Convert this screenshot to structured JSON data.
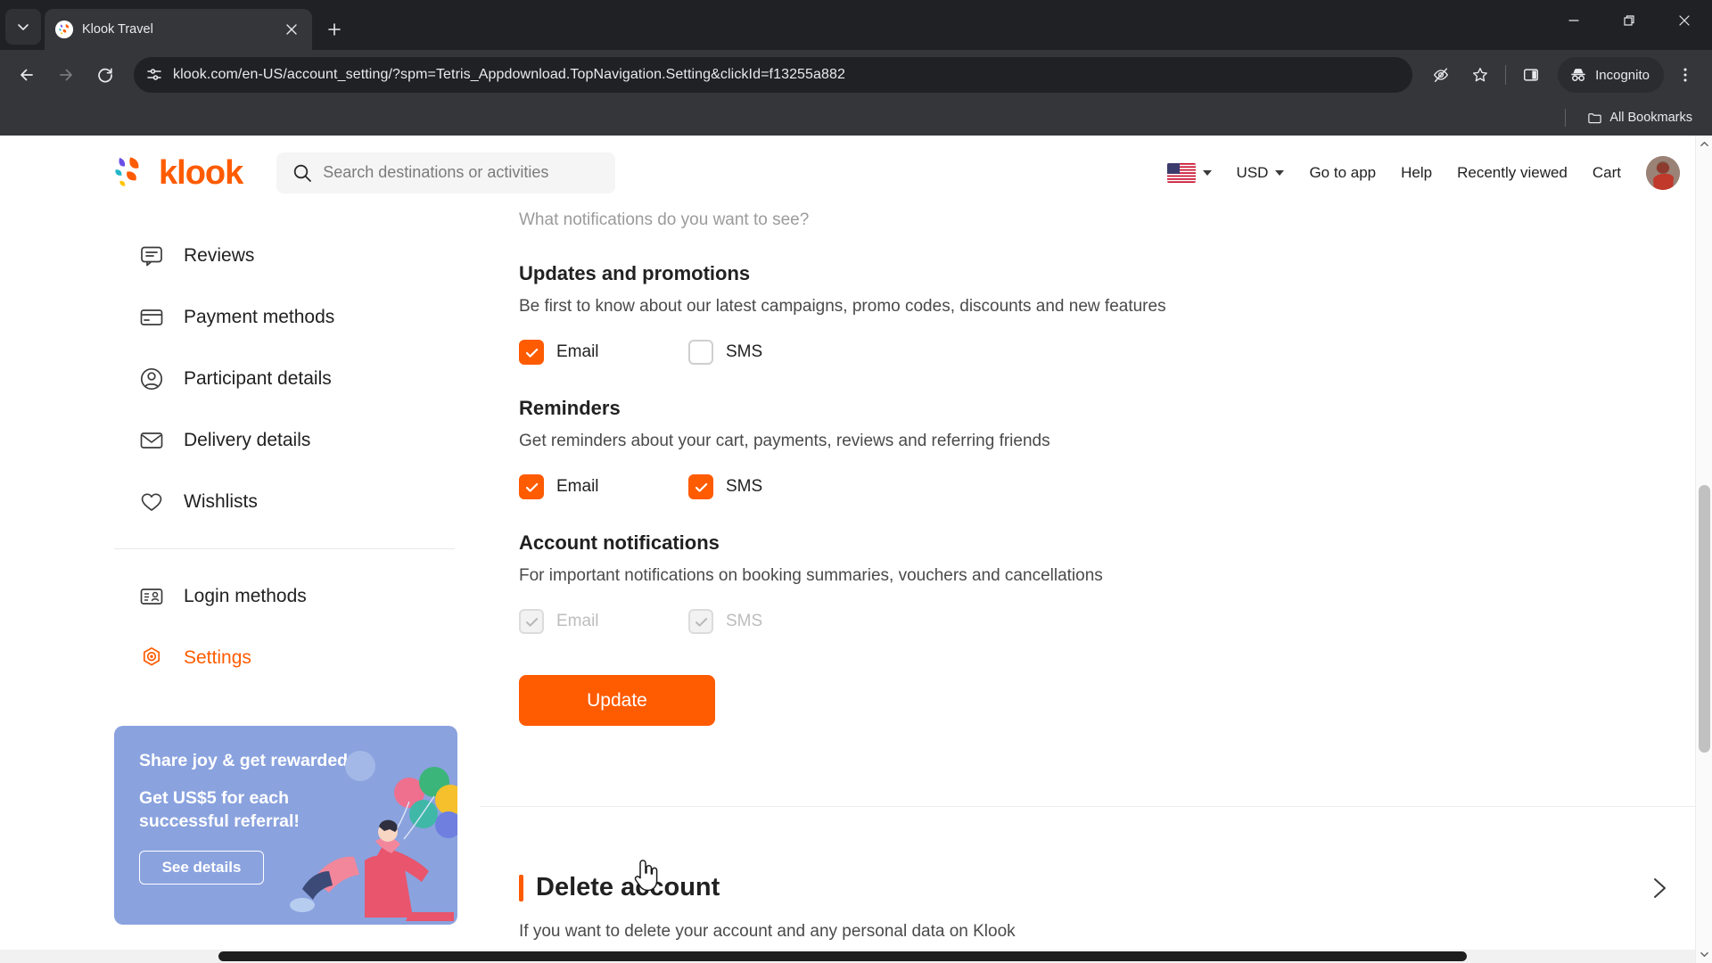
{
  "browser": {
    "tab": {
      "title": "Klook Travel",
      "favicon": "klook-favicon"
    },
    "tab_search_icon": "chevron-down-icon",
    "new_tab_icon": "plus-icon",
    "close_tab_icon": "close-icon",
    "window_controls": {
      "minimize": "minimize-icon",
      "maximize": "restore-icon",
      "close": "close-icon"
    },
    "nav": {
      "back_icon": "arrow-left-icon",
      "forward_icon": "arrow-right-icon",
      "reload_icon": "reload-icon"
    },
    "omnibox": {
      "site_icon": "page-settings-icon",
      "url": "klook.com/en-US/account_setting/?spm=Tetris_Appdownload.TopNavigation.Setting&clickId=f13255a882"
    },
    "toolbar_icons": [
      {
        "name": "tracking-protection-off-icon"
      },
      {
        "name": "bookmark-star-icon"
      },
      {
        "name": "side-panel-icon"
      },
      {
        "name": "kebab-menu-icon"
      }
    ],
    "incognito": {
      "label": "Incognito",
      "icon": "incognito-hat-icon"
    },
    "bookmarks_bar": {
      "all_bookmarks_label": "All Bookmarks",
      "folder_icon": "folder-icon"
    }
  },
  "site_header": {
    "logo_text": "klook",
    "search": {
      "placeholder": "Search destinations or activities",
      "icon": "search-icon"
    },
    "language": {
      "flag": "us-flag",
      "caret": "chevron-down-icon"
    },
    "currency": {
      "label": "USD",
      "caret": "chevron-down-icon"
    },
    "links": [
      {
        "label": "Go to app"
      },
      {
        "label": "Help"
      },
      {
        "label": "Recently viewed"
      },
      {
        "label": "Cart"
      }
    ],
    "avatar": "user-avatar"
  },
  "sidebar": {
    "items": [
      {
        "label": "Reviews",
        "icon": "comment-icon",
        "active": false
      },
      {
        "label": "Payment methods",
        "icon": "credit-card-icon",
        "active": false
      },
      {
        "label": "Participant details",
        "icon": "user-circle-icon",
        "active": false
      },
      {
        "label": "Delivery details",
        "icon": "envelope-icon",
        "active": false
      },
      {
        "label": "Wishlists",
        "icon": "heart-icon",
        "active": false
      }
    ],
    "items2": [
      {
        "label": "Login methods",
        "icon": "id-card-icon",
        "active": false
      },
      {
        "label": "Settings",
        "icon": "gear-target-icon",
        "active": true
      }
    ],
    "promo": {
      "title": "Share joy & get rewarded",
      "line1": "Get US$5 for each",
      "line2": "successful referral!",
      "button": "See details"
    }
  },
  "main": {
    "cut_heading": "What notifications do you want to see?",
    "sections": [
      {
        "title": "Updates and promotions",
        "desc": "Be first to know about our latest campaigns, promo codes, discounts and new features",
        "options": [
          {
            "label": "Email",
            "checked": true,
            "disabled": false
          },
          {
            "label": "SMS",
            "checked": false,
            "disabled": false
          }
        ]
      },
      {
        "title": "Reminders",
        "desc": "Get reminders about your cart, payments, reviews and referring friends",
        "options": [
          {
            "label": "Email",
            "checked": true,
            "disabled": false
          },
          {
            "label": "SMS",
            "checked": true,
            "disabled": false
          }
        ]
      },
      {
        "title": "Account notifications",
        "desc": "For important notifications on booking summaries, vouchers and cancellations",
        "options": [
          {
            "label": "Email",
            "checked": true,
            "disabled": true
          },
          {
            "label": "SMS",
            "checked": true,
            "disabled": true
          }
        ]
      }
    ],
    "update_button": "Update",
    "delete_account": {
      "title": "Delete account",
      "desc": "If you want to delete your account and any personal data on Klook",
      "chevron_icon": "chevron-right-icon"
    }
  },
  "colors": {
    "brand_orange": "#ff5b00",
    "promo_blue": "#8aa2de",
    "chrome_dark": "#202124",
    "toolbar_dark": "#35363a"
  }
}
